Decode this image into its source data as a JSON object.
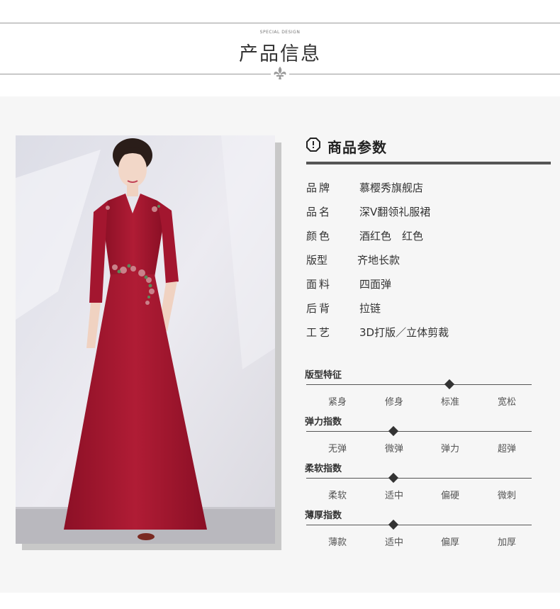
{
  "header": {
    "subtitle": "SPECIAL DESIGN",
    "title": "产品信息",
    "ornament_icon": "fleur-de-lis-icon"
  },
  "params": {
    "heading": "商品参数",
    "heading_icon": "info-icon",
    "rows": [
      {
        "label": "品牌",
        "value": "慕樱秀旗舰店"
      },
      {
        "label": "品名",
        "value": "深V翻领礼服裙"
      },
      {
        "label": "颜色",
        "value": "酒红色　红色"
      },
      {
        "label": "版型",
        "value": "齐地长款"
      },
      {
        "label": "面料",
        "value": "四面弹"
      },
      {
        "label": "后背",
        "value": "拉链"
      },
      {
        "label": "工艺",
        "value": "3D打版／立体剪裁"
      }
    ]
  },
  "features": [
    {
      "title": "版型特征",
      "options": [
        "紧身",
        "修身",
        "标准",
        "宽松"
      ],
      "selected": 2
    },
    {
      "title": "弹力指数",
      "options": [
        "无弹",
        "微弹",
        "弹力",
        "超弹"
      ],
      "selected": 1
    },
    {
      "title": "柔软指数",
      "options": [
        "柔软",
        "适中",
        "偏硬",
        "微刺"
      ],
      "selected": 1
    },
    {
      "title": "薄厚指数",
      "options": [
        "薄款",
        "适中",
        "偏厚",
        "加厚"
      ],
      "selected": 1
    }
  ],
  "colors": {
    "dress": "#a5162f",
    "accent": "#333333"
  }
}
